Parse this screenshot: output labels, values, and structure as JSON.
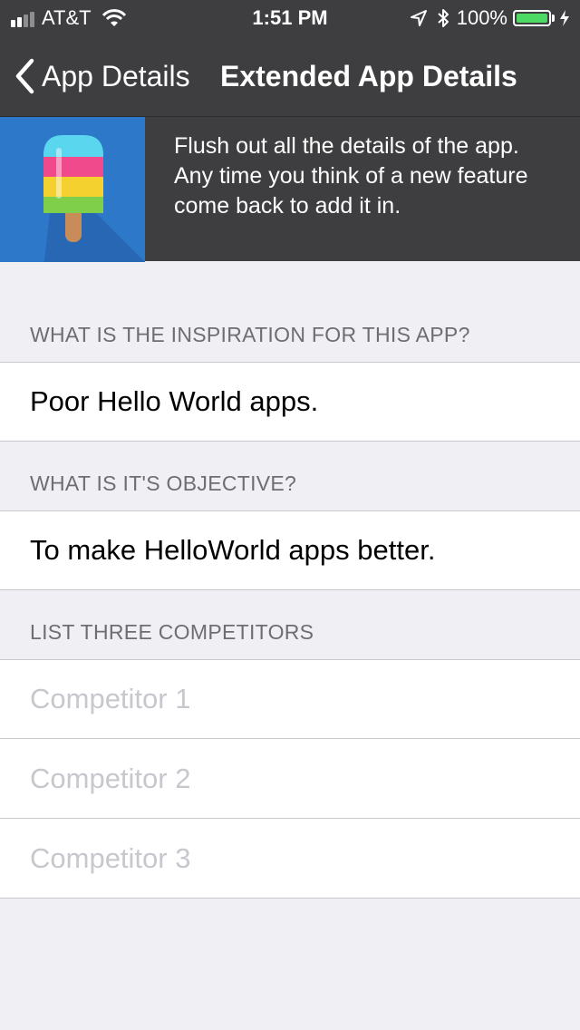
{
  "status_bar": {
    "carrier": "AT&T",
    "time": "1:51 PM",
    "battery": "100%",
    "battery_level": 1.0,
    "icons": [
      "signal-icon",
      "wifi-icon",
      "location-arrow-icon",
      "bluetooth-icon",
      "battery-icon",
      "charging-bolt-icon"
    ]
  },
  "nav": {
    "back_label": "App Details",
    "title": "Extended App Details"
  },
  "hero": {
    "description": "Flush out all the details of the app. Any time you think of a new feature come back to add it in.",
    "icon": "popsicle-app-icon"
  },
  "sections": {
    "inspiration": {
      "header": "WHAT IS THE INSPIRATION FOR THIS APP?",
      "value": "Poor Hello World apps."
    },
    "objective": {
      "header": "WHAT IS IT'S OBJECTIVE?",
      "value": "To make HelloWorld apps better."
    },
    "competitors": {
      "header": "LIST THREE COMPETITORS",
      "placeholders": [
        "Competitor 1",
        "Competitor 2",
        "Competitor 3"
      ]
    }
  },
  "colors": {
    "nav_background": "#3e3e40",
    "group_background": "#efeff4",
    "placeholder": "#c7c7cd",
    "battery_green": "#4cd964"
  }
}
